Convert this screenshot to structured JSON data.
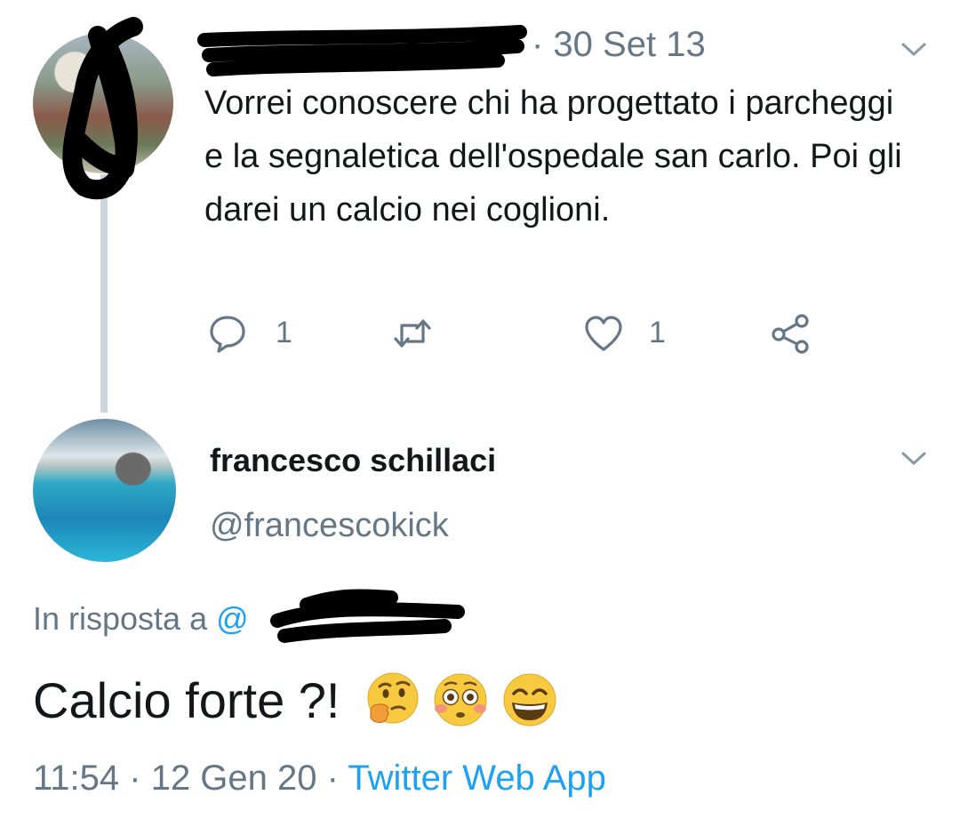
{
  "original_tweet": {
    "date": "· 30 Set 13",
    "text": "Vorrei conoscere chi ha progettato i parcheggi e la segnaletica dell'ospedale san carlo. Poi gli darei un calcio nei coglioni.",
    "reply_count": "1",
    "like_count": "1"
  },
  "reply_tweet": {
    "display_name": "francesco schillaci",
    "handle": "@francescokick",
    "in_reply_prefix": "In risposta a",
    "in_reply_mention": "@",
    "text": "Calcio forte ?!",
    "emojis": [
      "thinking-face",
      "flushed-face",
      "grinning-face"
    ],
    "time": "11:54",
    "date": "12 Gen 20",
    "source": "Twitter Web App"
  },
  "colors": {
    "secondary_text": "#657786",
    "link": "#1da1f2",
    "thread_line": "#ccd6dd"
  }
}
